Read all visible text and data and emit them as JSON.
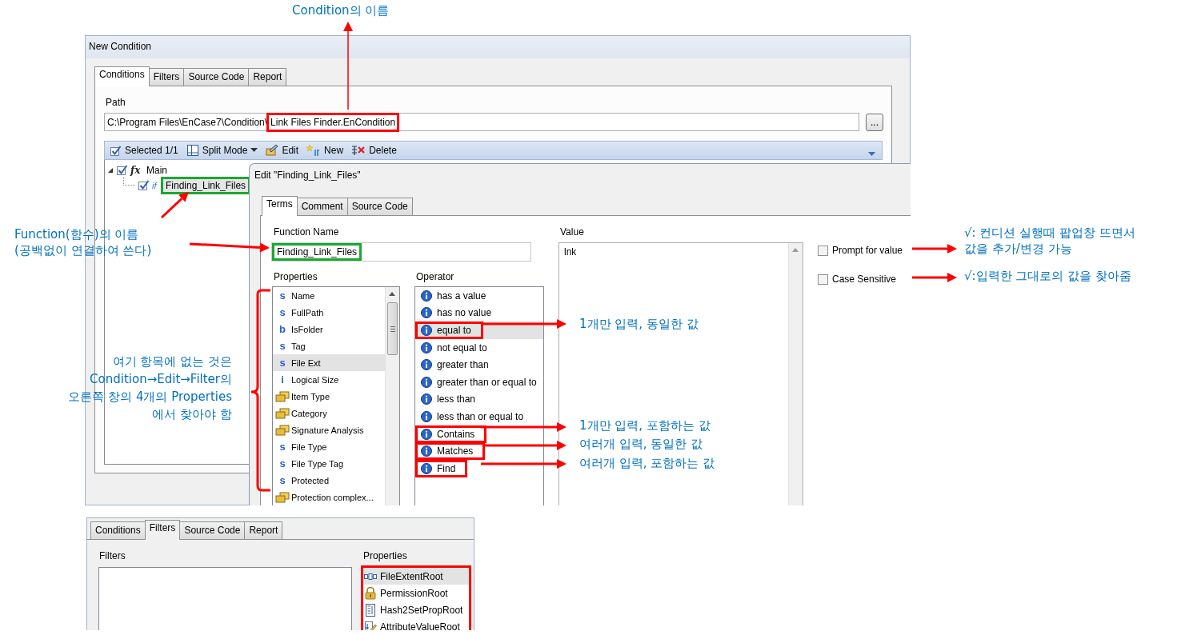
{
  "main_window": {
    "title": "New Condition",
    "tabs": [
      {
        "label": "Conditions",
        "selected": true
      },
      {
        "label": "Filters",
        "selected": false
      },
      {
        "label": "Source Code",
        "selected": false
      },
      {
        "label": "Report",
        "selected": false
      }
    ],
    "path_label": "Path",
    "path_field": {
      "value": "C:\\Program Files\\EnCase7\\Condition\\",
      "highlighted_part": "Link Files Finder.EnCondition"
    },
    "browse_button": "...",
    "toolbar": [
      {
        "kind": "select",
        "label": "Selected 1/1",
        "dropdown": false
      },
      {
        "kind": "split",
        "label": "Split Mode",
        "dropdown": true
      },
      {
        "kind": "edit",
        "label": "Edit",
        "dropdown": false
      },
      {
        "kind": "new",
        "label": "New",
        "dropdown": false
      },
      {
        "kind": "delete",
        "label": "Delete",
        "dropdown": false
      }
    ],
    "tree": [
      {
        "label": "Main",
        "icon_text": "fx",
        "checked": true,
        "expanded": true,
        "highlighted": false,
        "children": [
          {
            "label": "Finding_Link_Files",
            "icon_text": "if",
            "checked": true,
            "highlighted": true
          }
        ]
      }
    ]
  },
  "edit_dialog": {
    "title": "Edit \"Finding_Link_Files\"",
    "tabs": [
      {
        "label": "Terms",
        "selected": true
      },
      {
        "label": "Comment",
        "selected": false
      },
      {
        "label": "Source Code",
        "selected": false
      }
    ],
    "function_name_label": "Function Name",
    "function_name": {
      "value": "Finding_Link_Files",
      "highlighted": true
    },
    "properties_label": "Properties",
    "properties": [
      {
        "kind": "type",
        "type_mark": "s",
        "label": "Name",
        "selected": false
      },
      {
        "kind": "type",
        "type_mark": "s",
        "label": "FullPath",
        "selected": false
      },
      {
        "kind": "type",
        "type_mark": "b",
        "label": "IsFolder",
        "selected": false
      },
      {
        "kind": "type",
        "type_mark": "s",
        "label": "Tag",
        "selected": false
      },
      {
        "kind": "type",
        "type_mark": "s",
        "label": "File Ext",
        "selected": true
      },
      {
        "kind": "type",
        "type_mark": "i",
        "label": "Logical Size",
        "selected": false
      },
      {
        "kind": "group",
        "label": "Item Type",
        "selected": false
      },
      {
        "kind": "group",
        "label": "Category",
        "selected": false
      },
      {
        "kind": "group",
        "label": "Signature Analysis",
        "selected": false
      },
      {
        "kind": "type",
        "type_mark": "s",
        "label": "File Type",
        "selected": false
      },
      {
        "kind": "type",
        "type_mark": "s",
        "label": "File Type Tag",
        "selected": false
      },
      {
        "kind": "type",
        "type_mark": "s",
        "label": "Protected",
        "selected": false
      },
      {
        "kind": "group",
        "label": "Protection complex...",
        "selected": false
      }
    ],
    "operator_label": "Operator",
    "operators": [
      {
        "label": "has a value",
        "selected": false,
        "highlighted": false
      },
      {
        "label": "has no value",
        "selected": false,
        "highlighted": false
      },
      {
        "label": "equal to",
        "selected": true,
        "highlighted": true
      },
      {
        "label": "not equal to",
        "selected": false,
        "highlighted": false
      },
      {
        "label": "greater than",
        "selected": false,
        "highlighted": false
      },
      {
        "label": "greater than or equal to",
        "selected": false,
        "highlighted": false
      },
      {
        "label": "less than",
        "selected": false,
        "highlighted": false
      },
      {
        "label": "less than or equal to",
        "selected": false,
        "highlighted": false
      },
      {
        "label": "Contains",
        "selected": false,
        "highlighted": true
      },
      {
        "label": "Matches",
        "selected": false,
        "highlighted": true
      },
      {
        "label": "Find",
        "selected": false,
        "highlighted": true
      }
    ],
    "value_label": "Value",
    "value": "lnk",
    "options": [
      {
        "label": "Prompt for value",
        "checked": false
      },
      {
        "label": "Case Sensitive",
        "checked": false
      }
    ]
  },
  "filters_window": {
    "tabs": [
      {
        "label": "Conditions",
        "selected": false
      },
      {
        "label": "Filters",
        "selected": true
      },
      {
        "label": "Source Code",
        "selected": false
      },
      {
        "label": "Report",
        "selected": false
      }
    ],
    "filters_label": "Filters",
    "properties_label": "Properties",
    "properties_highlighted": true,
    "properties": [
      {
        "kind": "extent",
        "label": "FileExtentRoot",
        "selected": true
      },
      {
        "kind": "lock",
        "label": "PermissionRoot",
        "selected": false
      },
      {
        "kind": "sheet",
        "label": "Hash2SetPropRoot",
        "selected": false
      },
      {
        "kind": "pencil",
        "label": "AttributeValueRoot",
        "selected": false
      }
    ]
  },
  "callouts": [
    {
      "text": "Condition의 이름"
    },
    {
      "text": "Function(함수)의 이름\n(공백없이 연결하여 쓴다)"
    },
    {
      "text": "여기 항목에 없는 것은\nCondition→Edit→Filter의\n오른쪽 창의 4개의 Properties\n에서 찾아야 함"
    },
    {
      "text": "1개만 입력, 동일한 값"
    },
    {
      "text": "1개만 입력, 포함하는 값"
    },
    {
      "text": "여러개 입력, 동일한 값"
    },
    {
      "text": "여러개 입력, 포함하는 값"
    },
    {
      "text": "√: 컨디션 실행때 팝업창 뜨면서\n값을 추가/변경 가능"
    },
    {
      "text": "√:입력한 그대로의 값을 찾아줌"
    }
  ]
}
